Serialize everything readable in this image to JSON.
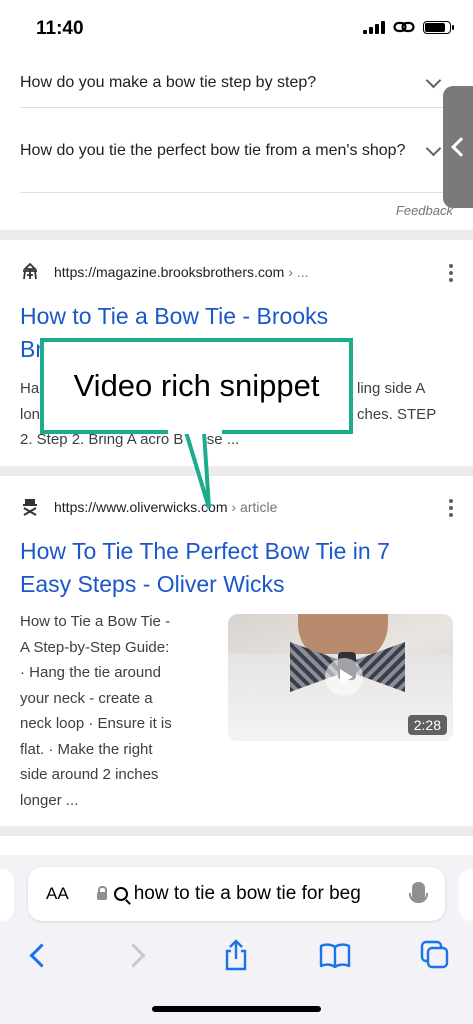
{
  "status": {
    "time": "11:40"
  },
  "paa": {
    "questions": [
      "How do you make a bow tie step by step?",
      "How do you tie the perfect bow tie from a men's shop?"
    ],
    "feedback": "Feedback"
  },
  "results": [
    {
      "url": "https://magazine.brooksbrothers.com",
      "url_tail": "› ...",
      "title_line1": "How to Tie a Bow Tie - Brooks",
      "title_line2": "Br",
      "snippet": [
        "Ha",
        "lon",
        "2. Step 2. Bring A acro   B close ..."
      ],
      "snippet_right": [
        "ling side A",
        "ches. STEP"
      ]
    },
    {
      "url": "https://www.oliverwicks.com",
      "url_tail": "› article",
      "title_line1": "How To Tie The Perfect Bow Tie in 7",
      "title_line2": "Easy Steps - Oliver Wicks",
      "snippet": [
        "How to Tie a Bow Tie -",
        "A Step-by-Step Guide:",
        "· Hang the tie around",
        "your neck - create a",
        "neck loop · Ensure it is",
        "flat. · Make the right",
        "side around 2 inches",
        "longer ..."
      ],
      "video_duration": "2:28"
    }
  ],
  "callout": {
    "text": "Video rich snippet",
    "color": "#1dab8c"
  },
  "address_bar": {
    "aa": "AA",
    "query": "how to tie a bow tie for beg"
  },
  "icons": {
    "back": "chevron-left-icon",
    "forward": "chevron-right-icon",
    "share": "share-icon",
    "bookmarks": "book-icon",
    "tabs": "tabs-icon"
  }
}
